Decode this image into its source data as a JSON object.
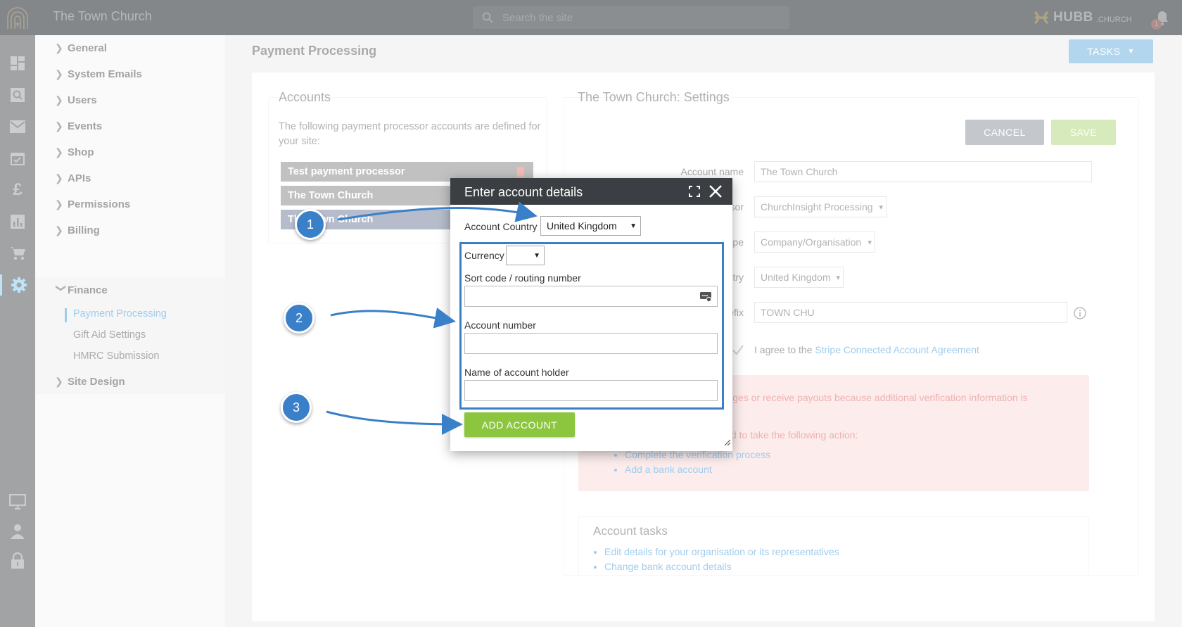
{
  "header": {
    "site_title": "The Town Church",
    "search_placeholder": "Search the site",
    "brand_name": "HUBB",
    "brand_suffix": ".CHURCH",
    "notification_count": "1"
  },
  "rail_icons": [
    "dashboard-icon",
    "search-icon",
    "mail-icon",
    "calendar-check-icon",
    "pound-icon",
    "chart-icon",
    "cart-icon",
    "gear-icon",
    "monitor-icon",
    "user-icon",
    "lock-icon"
  ],
  "sidenav": {
    "items": [
      {
        "label": "General"
      },
      {
        "label": "System Emails"
      },
      {
        "label": "Users"
      },
      {
        "label": "Events"
      },
      {
        "label": "Shop"
      },
      {
        "label": "APIs"
      },
      {
        "label": "Permissions"
      },
      {
        "label": "Billing"
      },
      {
        "label": "Finance"
      },
      {
        "label": "Site Design"
      }
    ],
    "finance_sub": [
      {
        "label": "Payment Processing",
        "active": true
      },
      {
        "label": "Gift Aid Settings"
      },
      {
        "label": "HMRC Submission"
      }
    ]
  },
  "page": {
    "title": "Payment Processing",
    "tasks_label": "TASKS"
  },
  "accounts": {
    "title": "Accounts",
    "description": "The following payment processor accounts are defined for your site:",
    "rows": [
      {
        "label": "Test payment processor"
      },
      {
        "label": "The Town Church"
      },
      {
        "label": "The Town Church"
      }
    ]
  },
  "settings": {
    "title": "The Town Church: Settings",
    "cancel_label": "CANCEL",
    "save_label": "SAVE",
    "fields": [
      {
        "label": "Account name",
        "value": "The Town Church"
      },
      {
        "label": "Payment processor",
        "value": "ChurchInsight Processing"
      },
      {
        "label": "Account type",
        "value": "Company/Organisation"
      },
      {
        "label": "Account country",
        "value": "United Kingdom"
      },
      {
        "label": "Statement prefix",
        "value": "TOWN CHU"
      }
    ],
    "agree_prefix": "I agree to the ",
    "agree_link": "Stripe Connected Account Agreement",
    "alert": {
      "line1": "This account cannot create charges or receive payouts because additional verification information is",
      "line2": "To enable this account, you need to take the following action:",
      "actions": [
        "Complete the verification process",
        "Add a bank account"
      ]
    },
    "tasks_title": "Account tasks",
    "tasks": [
      "Edit details for your organisation or its representatives",
      "Change bank account details"
    ]
  },
  "dialog": {
    "title": "Enter account details",
    "country_label": "Account Country",
    "country_value": "United Kingdom",
    "currency_label": "Currency",
    "currency_value": "",
    "sort_code_label": "Sort code / routing number",
    "account_number_label": "Account number",
    "holder_label": "Name of account holder",
    "add_label": "ADD ACCOUNT"
  },
  "callouts": [
    "1",
    "2",
    "3"
  ],
  "colors": {
    "accent_blue": "#3a80c9",
    "add_green": "#8cc63e",
    "header_dark": "#3b3f44",
    "link_blue": "#2a8fd6"
  }
}
